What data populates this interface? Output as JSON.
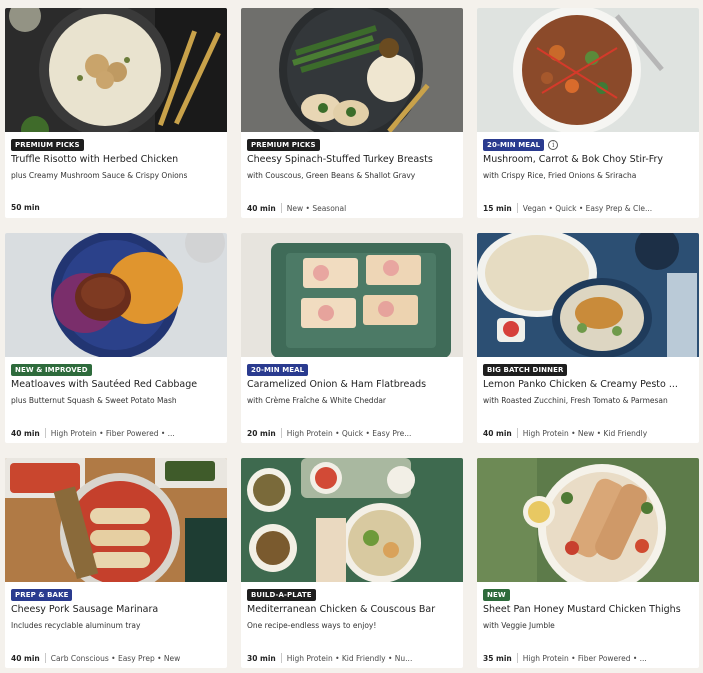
{
  "colors": {
    "premium": "#1e1e1e",
    "quick": "#2a3b8f",
    "improved": "#2e6b3c",
    "dark": "#1e1e1e",
    "bake": "#2a3b8f",
    "build": "#1e1e1e",
    "new": "#2e6b3c"
  },
  "meals": [
    {
      "badge": "PREMIUM PICKS",
      "badge_color": "#1e1e1e",
      "info": false,
      "title": "Truffle Risotto with Herbed Chicken",
      "subtitle": "plus Creamy Mushroom Sauce & Crispy Onions",
      "time": "50 min",
      "tags": ""
    },
    {
      "badge": "PREMIUM PICKS",
      "badge_color": "#1e1e1e",
      "info": false,
      "title": "Cheesy Spinach-Stuffed Turkey Breasts",
      "subtitle": "with Couscous, Green Beans & Shallot Gravy",
      "time": "40 min",
      "tags": "New • Seasonal"
    },
    {
      "badge": "20-MIN MEAL",
      "badge_color": "#2a3b8f",
      "info": true,
      "info_icon": "info-icon",
      "title": "Mushroom, Carrot & Bok Choy Stir-Fry",
      "subtitle": "with Crispy Rice, Fried Onions & Sriracha",
      "time": "15 min",
      "tags": "Vegan • Quick • Easy Prep & Cle..."
    },
    {
      "badge": "NEW & IMPROVED",
      "badge_color": "#2e6b3c",
      "info": false,
      "title": "Meatloaves with Sautéed Red Cabbage",
      "subtitle": "plus Butternut Squash & Sweet Potato Mash",
      "time": "40 min",
      "tags": "High Protein • Fiber Powered • ..."
    },
    {
      "badge": "20-MIN MEAL",
      "badge_color": "#2a3b8f",
      "info": false,
      "title": "Caramelized Onion & Ham Flatbreads",
      "subtitle": "with Crème Fraîche & White Cheddar",
      "time": "20 min",
      "tags": "High Protein • Quick • Easy Pre..."
    },
    {
      "badge": "BIG BATCH DINNER",
      "badge_color": "#1e1e1e",
      "info": false,
      "title": "Lemon Panko Chicken & Creamy Pesto ...",
      "subtitle": "with Roasted Zucchini, Fresh Tomato & Parmesan",
      "time": "40 min",
      "tags": "High Protein • New • Kid Friendly"
    },
    {
      "badge": "PREP & BAKE",
      "badge_color": "#2a3b8f",
      "info": false,
      "title": "Cheesy Pork Sausage Marinara",
      "subtitle": "Includes recyclable aluminum tray",
      "time": "40 min",
      "tags": "Carb Conscious • Easy Prep • New"
    },
    {
      "badge": "BUILD-A-PLATE",
      "badge_color": "#1e1e1e",
      "info": false,
      "title": "Mediterranean Chicken & Couscous Bar",
      "subtitle": "One recipe-endless ways to enjoy!",
      "time": "30 min",
      "tags": "High Protein • Kid Friendly • Nu..."
    },
    {
      "badge": "NEW",
      "badge_color": "#2e6b3c",
      "info": false,
      "title": "Sheet Pan Honey Mustard Chicken Thighs",
      "subtitle": "with Veggie Jumble",
      "time": "35 min",
      "tags": "High Protein • Fiber Powered • ..."
    }
  ]
}
